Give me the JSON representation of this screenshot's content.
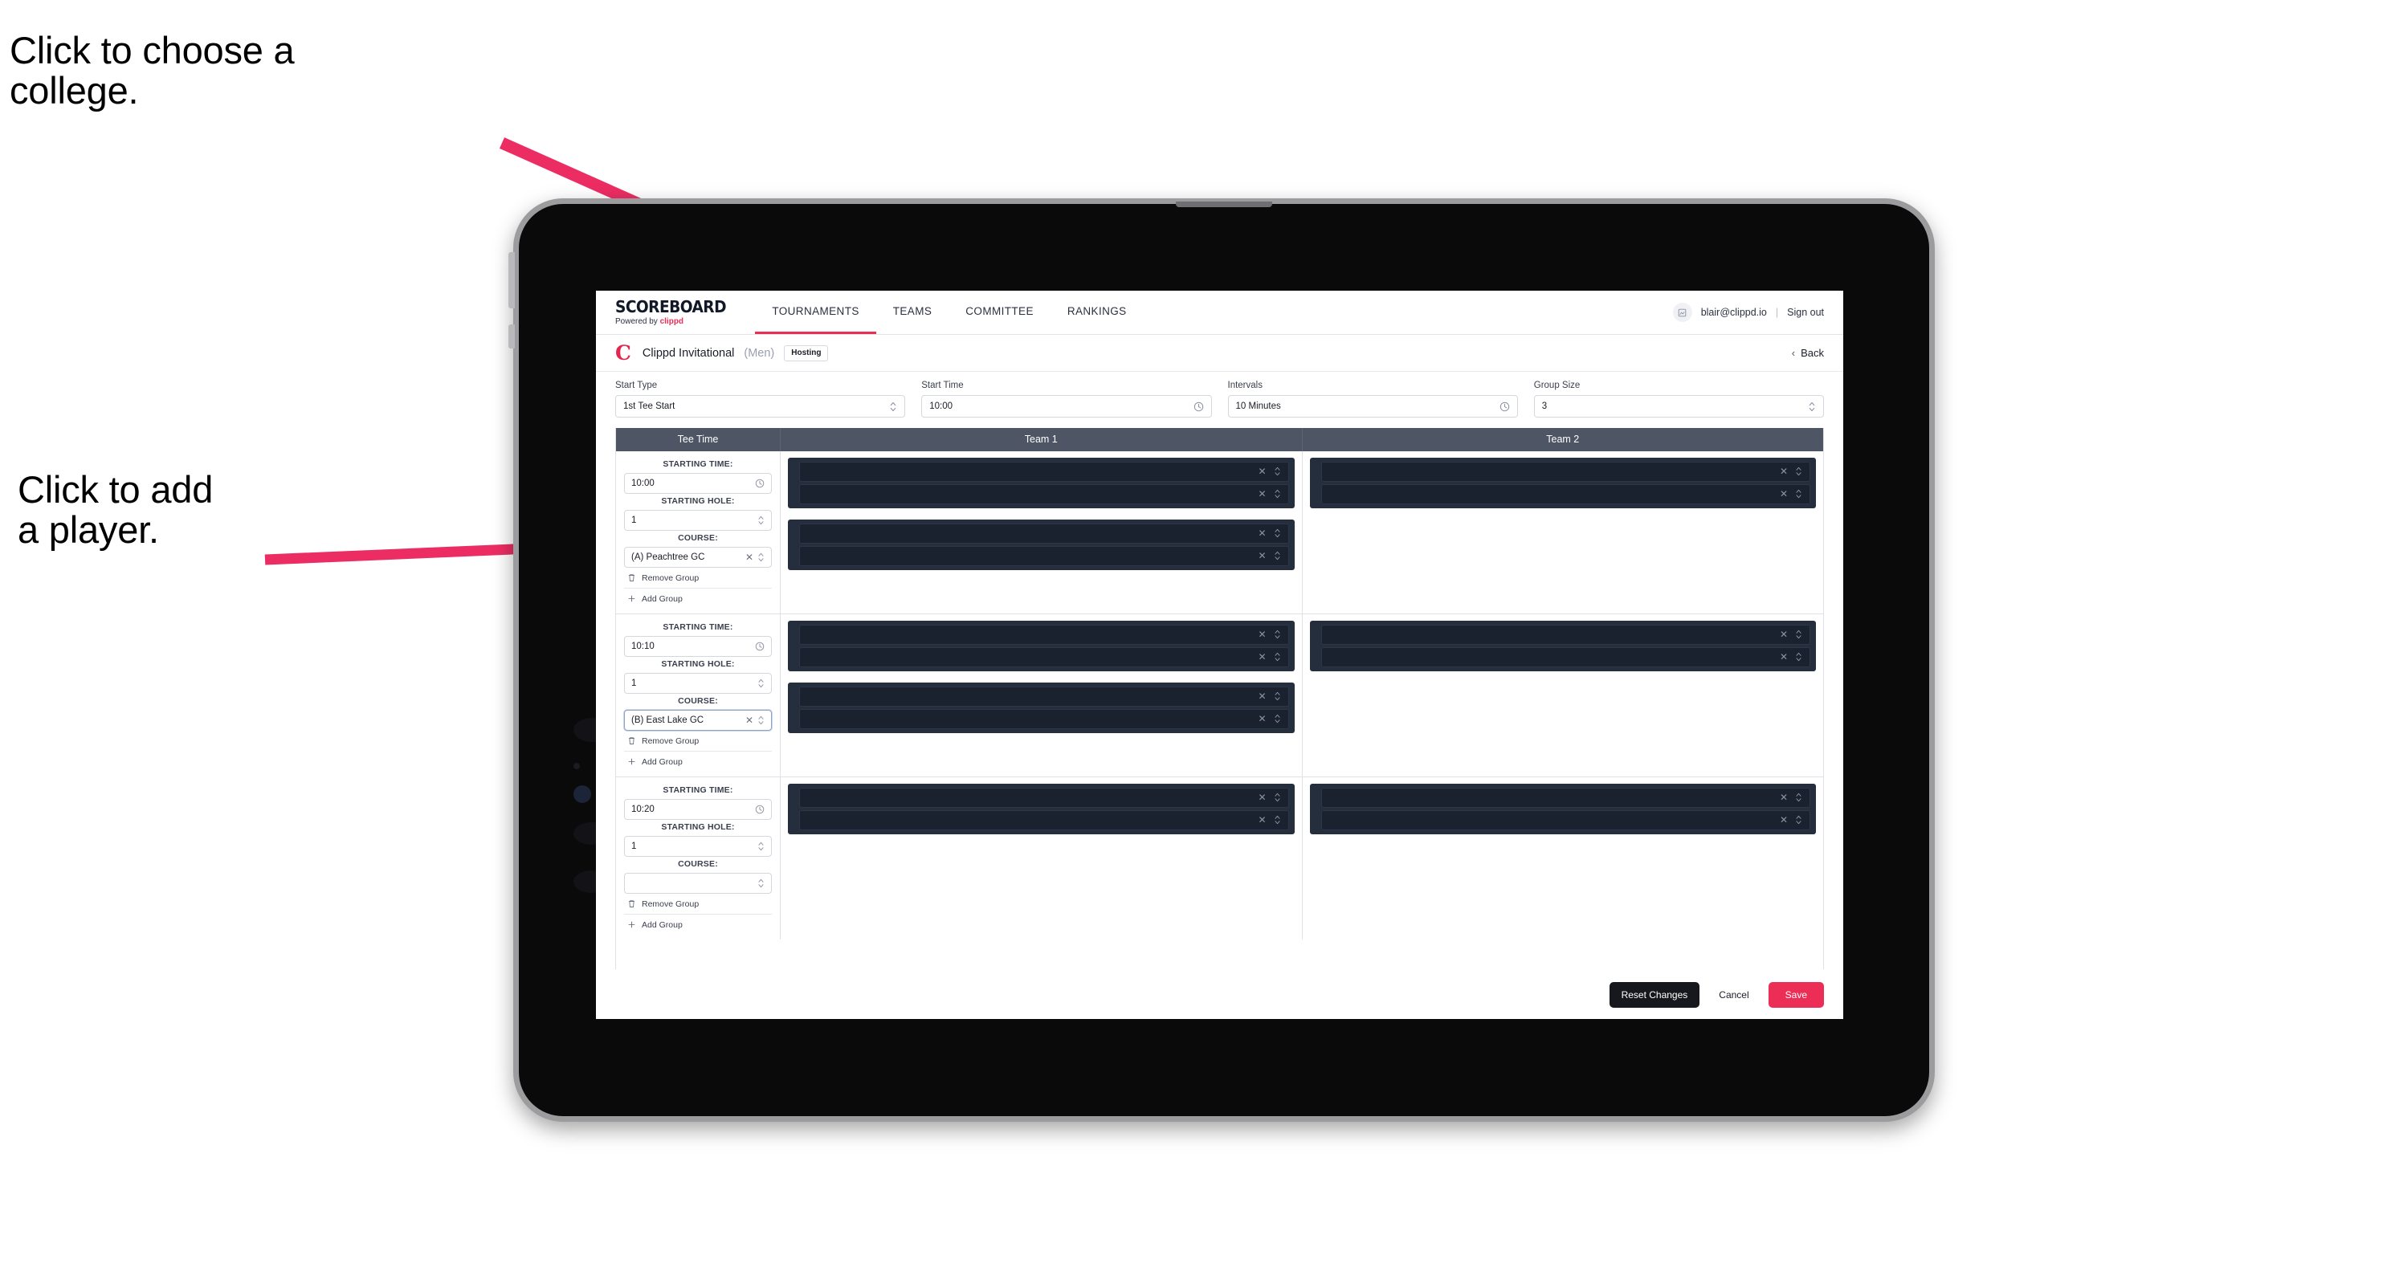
{
  "annotations": [
    {
      "id": "college",
      "text": "Click to choose a\ncollege."
    },
    {
      "id": "player",
      "text": "Click to add\na player."
    }
  ],
  "colors": {
    "accent": "#ec2d55",
    "arrow": "#ec2d63",
    "table_header": "#4e5565",
    "player_group_bg": "#252e3d",
    "player_row_bg": "#1a2230",
    "dark_button": "#16181d"
  },
  "topnav": {
    "logo_word": "SCOREBOARD",
    "logo_sub_prefix": "Powered by ",
    "logo_sub_brand": "clippd",
    "tabs": [
      {
        "label": "TOURNAMENTS",
        "active": true
      },
      {
        "label": "TEAMS",
        "active": false
      },
      {
        "label": "COMMITTEE",
        "active": false
      },
      {
        "label": "RANKINGS",
        "active": false
      }
    ],
    "avatar_icon": "user-avatar-icon",
    "email": "blair@clippd.io",
    "separator": "|",
    "signout_label": "Sign out"
  },
  "subheader": {
    "tournament_logo": "C",
    "tournament_name": "Clippd Invitational",
    "gender": "(Men)",
    "hosting_badge": "Hosting",
    "back_label": "Back",
    "back_chevron": "‹"
  },
  "filters": [
    {
      "label": "Start Type",
      "value": "1st Tee Start",
      "icon": "chevron-updown-icon"
    },
    {
      "label": "Start Time",
      "value": "10:00",
      "icon": "clock-icon"
    },
    {
      "label": "Intervals",
      "value": "10 Minutes",
      "icon": "clock-icon"
    },
    {
      "label": "Group Size",
      "value": "3",
      "icon": "chevron-updown-icon"
    }
  ],
  "table": {
    "columns": [
      "Tee Time",
      "Team 1",
      "Team 2"
    ],
    "labels": {
      "starting_time": "STARTING TIME:",
      "starting_hole": "STARTING HOLE:",
      "course": "COURSE:",
      "remove_group": "Remove Group",
      "add_group": "Add Group"
    },
    "groups": [
      {
        "starting_time": "10:00",
        "starting_hole": "1",
        "course": "(A) Peachtree GC",
        "course_focused": false,
        "team1_groups": [
          {
            "rows": 2
          },
          {
            "rows": 2
          }
        ],
        "team2_groups": [
          {
            "rows": 2
          }
        ]
      },
      {
        "starting_time": "10:10",
        "starting_hole": "1",
        "course": "(B) East Lake GC",
        "course_focused": true,
        "team1_groups": [
          {
            "rows": 2
          },
          {
            "rows": 2
          }
        ],
        "team2_groups": [
          {
            "rows": 2
          }
        ]
      },
      {
        "starting_time": "10:20",
        "starting_hole": "1",
        "course": "",
        "course_focused": false,
        "team1_groups": [
          {
            "rows": 2
          }
        ],
        "team2_groups": [
          {
            "rows": 2
          }
        ]
      }
    ]
  },
  "footer": {
    "reset_label": "Reset Changes",
    "cancel_label": "Cancel",
    "save_label": "Save"
  }
}
